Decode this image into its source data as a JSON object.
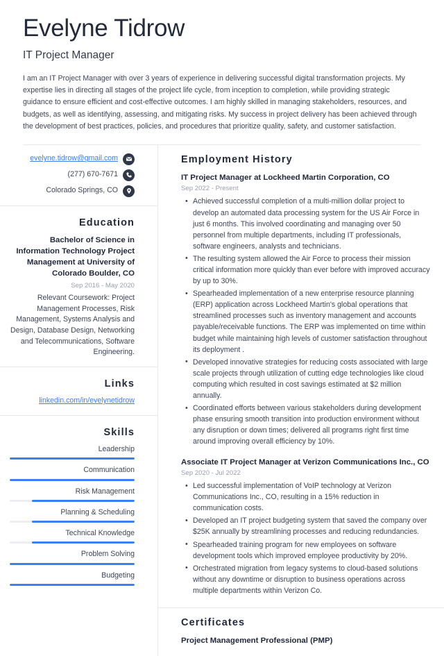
{
  "header": {
    "name": "Evelyne Tidrow",
    "job_title": "IT Project Manager",
    "summary": "I am an IT Project Manager with over 3 years of experience in delivering successful digital transformation projects. My expertise lies in directing all stages of the project life cycle, from inception to completion, while providing strategic guidance to ensure efficient and cost-effective outcomes. I am highly skilled in managing stakeholders, resources, and budgets, as well as identifying, assessing, and mitigating risks. My success in project delivery has been achieved through the development of best practices, policies, and procedures that prioritize quality, safety, and customer satisfaction."
  },
  "contact": {
    "items": [
      {
        "text": "evelyne.tidrow@gmail.com",
        "icon": "envelope-icon",
        "is_link": true
      },
      {
        "text": "(277) 670-7671",
        "icon": "phone-icon",
        "is_link": false
      },
      {
        "text": "Colorado Springs, CO",
        "icon": "location-pin-icon",
        "is_link": false
      }
    ]
  },
  "education": {
    "heading": "Education",
    "degree": "Bachelor of Science in Information Technology Project Management at University of Colorado Boulder, CO",
    "dates": "Sep 2016 - May 2020",
    "description": "Relevant Coursework: Project Management Processes, Risk Management, Systems Analysis and Design, Database Design, Networking and Telecommunications, Software Engineering."
  },
  "links": {
    "heading": "Links",
    "items": [
      {
        "text": "linkedin.com/in/evelynetidrow"
      }
    ]
  },
  "skills": {
    "heading": "Skills",
    "items": [
      {
        "name": "Leadership",
        "level": 100
      },
      {
        "name": "Communication",
        "level": 100
      },
      {
        "name": "Risk Management",
        "level": 82
      },
      {
        "name": "Planning & Scheduling",
        "level": 82
      },
      {
        "name": "Technical Knowledge",
        "level": 82
      },
      {
        "name": "Problem Solving",
        "level": 100
      },
      {
        "name": "Budgeting",
        "level": 100
      }
    ]
  },
  "employment": {
    "heading": "Employment History",
    "jobs": [
      {
        "title": "IT Project Manager at Lockheed Martin Corporation, CO",
        "dates": "Sep 2022 - Present",
        "bullets": [
          "Achieved successful completion of a multi-million dollar project to develop an automated data processing system for the US Air Force in just 6 months. This involved coordinating and managing over 50 personnel from multiple departments, including IT professionals, software engineers, analysts and technicians.",
          "The resulting system allowed the Air Force to process their mission critical information more quickly than ever before with improved accuracy by up to 30%.",
          "Spearheaded implementation of a new enterprise resource planning (ERP) application across Lockheed Martin's global operations that streamlined processes such as inventory management and accounts payable/receivable functions. The ERP was implemented on time within budget while maintaining high levels of customer satisfaction throughout its deployment .",
          "Developed innovative strategies for reducing costs associated with large scale projects through utilization of cutting edge technologies like cloud computing which resulted in cost savings estimated at $2 million annually.",
          "Coordinated efforts between various stakeholders during development phase ensuring smooth transition into production environment without any disruption or down times; delivered all programs right first time around improving overall efficiency by 10%."
        ]
      },
      {
        "title": "Associate IT Project Manager at Verizon Communications Inc., CO",
        "dates": "Sep 2020 - Jul 2022",
        "bullets": [
          "Led successful implementation of VoIP technology at Verizon Communications Inc., CO, resulting in a 15% reduction in communication costs.",
          "Developed an IT project budgeting system that saved the company over $25K annually by streamlining processes and reducing redundancies.",
          "Spearheaded training program for new employees on software development tools which improved employee productivity by 20%.",
          "Orchestrated migration from legacy systems to cloud-based solutions without any downtime or disruption to business operations across multiple departments within Verizon Co."
        ]
      }
    ]
  },
  "certificates": {
    "heading": "Certificates",
    "items": [
      {
        "name": "Project Management Professional (PMP)"
      }
    ]
  },
  "colors": {
    "accent_blue": "#3b7ff0",
    "heading_navy": "#232a3b",
    "body_text": "#3f4557",
    "muted_gray": "#9aa0ad",
    "divider": "#e6e8ec",
    "icon_circle": "#2f3749",
    "bar_track": "#eceef1"
  }
}
